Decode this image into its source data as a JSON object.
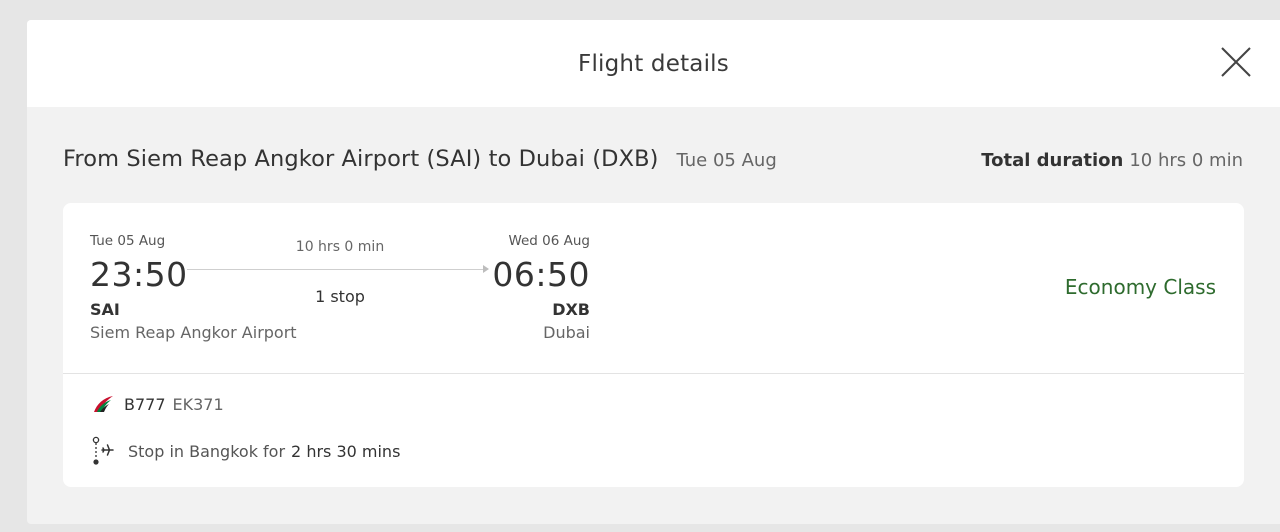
{
  "header": {
    "title": "Flight details"
  },
  "route": {
    "title": "From Siem Reap Angkor Airport (SAI) to Dubai (DXB)",
    "date": "Tue 05 Aug",
    "total_duration_label": "Total duration",
    "total_duration_value": "10 hrs 0 min"
  },
  "segment": {
    "departure": {
      "date": "Tue 05 Aug",
      "time": "23:50",
      "code": "SAI",
      "name": "Siem Reap Angkor Airport"
    },
    "arrival": {
      "date": "Wed 06 Aug",
      "time": "06:50",
      "code": "DXB",
      "name": "Dubai"
    },
    "duration": "10 hrs 0 min",
    "stops": "1 stop",
    "cabin": "Economy Class"
  },
  "info": {
    "aircraft": "B777",
    "flight_number": "EK371",
    "stop_text": "Stop in Bangkok for",
    "stop_duration": "2 hrs 30 mins"
  },
  "colors": {
    "accent_green": "#2e6b2e",
    "airline_red": "#c8102e",
    "airline_green": "#00843d"
  },
  "icons": [
    "close-icon",
    "airline-logo-icon",
    "stopover-icon"
  ]
}
